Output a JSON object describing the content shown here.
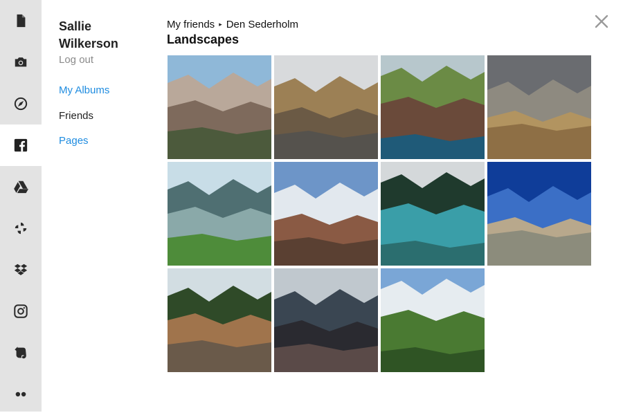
{
  "sidebar": {
    "icons": [
      {
        "name": "file-icon",
        "label": "Files",
        "active": false
      },
      {
        "name": "camera-icon",
        "label": "Camera",
        "active": false
      },
      {
        "name": "compass-icon",
        "label": "Explore",
        "active": false
      },
      {
        "name": "facebook-icon",
        "label": "Facebook",
        "active": true
      },
      {
        "name": "google-drive-icon",
        "label": "Google Drive",
        "active": false
      },
      {
        "name": "pinwheel-icon",
        "label": "Google Photos",
        "active": false
      },
      {
        "name": "dropbox-icon",
        "label": "Dropbox",
        "active": false
      },
      {
        "name": "instagram-icon",
        "label": "Instagram",
        "active": false
      },
      {
        "name": "evernote-icon",
        "label": "Evernote",
        "active": false
      },
      {
        "name": "more-icon",
        "label": "More",
        "active": false
      }
    ]
  },
  "user": {
    "first_name": "Sallie",
    "last_name": "Wilkerson",
    "logout_label": "Log out"
  },
  "nav": {
    "items": [
      {
        "label": "My Albums",
        "style": "link"
      },
      {
        "label": "Friends",
        "style": "plain"
      },
      {
        "label": "Pages",
        "style": "link"
      }
    ]
  },
  "breadcrumb": {
    "parent": "My friends",
    "current": "Den Sederholm",
    "separator": "▸"
  },
  "album": {
    "title": "Landscapes"
  },
  "photos": [
    {
      "name": "canyon-cliffs",
      "colors": [
        "#8fb8d8",
        "#b9a89a",
        "#7e6a5c",
        "#4c5a3c"
      ]
    },
    {
      "name": "mountain-road",
      "colors": [
        "#d8dadc",
        "#9c8055",
        "#6b5a45",
        "#55524d"
      ]
    },
    {
      "name": "sea-arch",
      "colors": [
        "#b7c7cc",
        "#6b8b45",
        "#6a4a3a",
        "#1f5a78"
      ]
    },
    {
      "name": "desert-plateau",
      "colors": [
        "#6a6c70",
        "#8e8a80",
        "#b29460",
        "#8e6f45"
      ]
    },
    {
      "name": "lake-hills",
      "colors": [
        "#c8dde7",
        "#4f6f72",
        "#8aa9a9",
        "#4e8c3a"
      ]
    },
    {
      "name": "red-canyon-sky",
      "colors": [
        "#6d95c8",
        "#e2e8ee",
        "#8a5a44",
        "#5a4032"
      ]
    },
    {
      "name": "turquoise-lake",
      "colors": [
        "#d4d8da",
        "#1f3a2d",
        "#3a9ea8",
        "#2b6e6f"
      ]
    },
    {
      "name": "blue-sky-ridge",
      "colors": [
        "#0f3d99",
        "#3b6fc6",
        "#b8a88c",
        "#8c8c7c"
      ]
    },
    {
      "name": "fishing-lake",
      "colors": [
        "#d2dde2",
        "#2f4a28",
        "#a0744c",
        "#6a5a4a"
      ]
    },
    {
      "name": "dusk-lake",
      "colors": [
        "#c0c8ce",
        "#3a4652",
        "#2a2a30",
        "#5a4a48"
      ]
    },
    {
      "name": "green-valley",
      "colors": [
        "#7aa6d6",
        "#e6ecf0",
        "#4a7a32",
        "#2f5424"
      ]
    }
  ],
  "close_label": "Close"
}
